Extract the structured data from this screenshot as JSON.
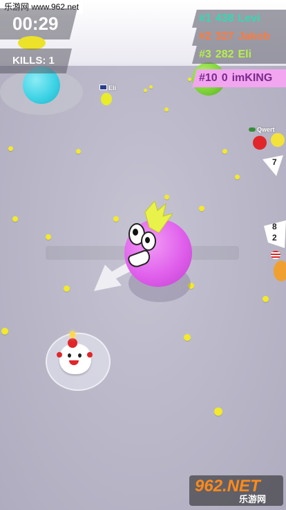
{
  "watermark": {
    "top_text": "乐游网 www.962.net",
    "logo_big": "962.NET",
    "logo_sub": "乐游网"
  },
  "hud": {
    "timer": "00:29",
    "kills_label": "KILLS: 1"
  },
  "leaderboard": [
    {
      "rank": "#1",
      "score": "438",
      "name": "Levi",
      "color": "#33d9b2",
      "highlight": false
    },
    {
      "rank": "#2",
      "score": "327",
      "name": "Jakob",
      "color": "#ff7a3d",
      "highlight": false
    },
    {
      "rank": "#3",
      "score": "282",
      "name": "Eli",
      "color": "#b6f04a",
      "highlight": false
    },
    {
      "rank": "#10",
      "score": "0",
      "name": "imKING",
      "color": "#7a2a8c",
      "highlight": true,
      "highlight_bg": "#f2a6f0"
    }
  ],
  "player_tags": [
    "Eli",
    "Qwert"
  ],
  "offscreen_markers": [
    "7",
    "8",
    "2"
  ],
  "colors": {
    "player_blob": "#e060ec",
    "player_crest": "#e9f24a",
    "cyan_blob": "#3fd3e6",
    "green_blob": "#7fd43a",
    "pellet": "#f2ea2a",
    "floor": "#b9b7c7"
  }
}
